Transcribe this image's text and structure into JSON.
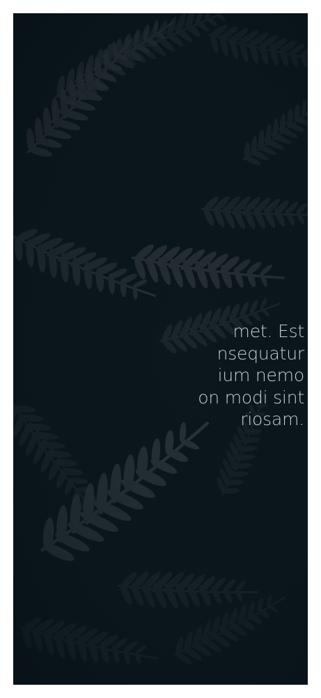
{
  "hero": {
    "background": "dark-fern-leaves-photo",
    "colors": {
      "background": "#0b171d",
      "leaf": "#2a3237",
      "text": "#c4ccd0"
    }
  },
  "paragraph": {
    "lines": [
      "met. Est",
      "nsequatur",
      "ium nemo",
      "on modi sint",
      "riosam."
    ]
  }
}
